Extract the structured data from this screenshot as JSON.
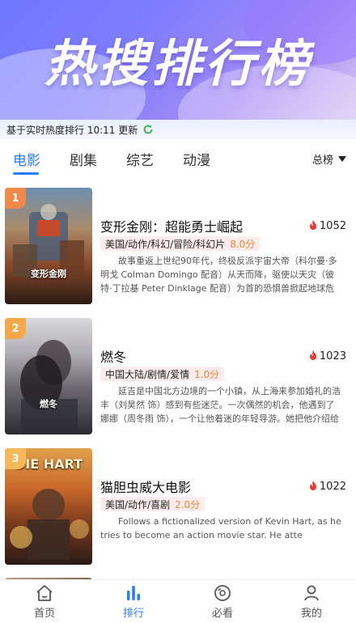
{
  "banner": {
    "title": "热搜排行榜"
  },
  "update": {
    "text": "基于实时热度排行 10:11 更新"
  },
  "tabs": [
    {
      "label": "电影",
      "active": true
    },
    {
      "label": "剧集",
      "active": false
    },
    {
      "label": "综艺",
      "active": false
    },
    {
      "label": "动漫",
      "active": false
    }
  ],
  "sort": {
    "label": "总榜"
  },
  "items": [
    {
      "rank": "1",
      "title": "变形金刚：超能勇士崛起",
      "heat": "1052",
      "tags": "美国/动作/科幻/冒险/科幻片",
      "score": "8.0分",
      "desc": "故事重返上世纪90年代，终极反派宇宙大帝（科尔曼·多明戈 Colman Domingo 配音）从天而降，驱使以天灾（彼特·丁拉基 Peter Dinklage 配音）为首的恐惧兽掀起地球危机。绝境",
      "poster_caption": "变形金刚",
      "badge_color": "#f08a4b"
    },
    {
      "rank": "2",
      "title": "燃冬",
      "heat": "1023",
      "tags": "中国大陆/剧情/爱情",
      "score": "1.0分",
      "desc": "延吉是中国北方边境的一个小镇，从上海来参加婚礼的浩丰（刘昊然 饰）感到有些迷茫。一次偶然的机会，他遇到了娜娜（周冬雨 饰），一个让他着迷的年轻导游。她把他介绍给一个厨师朋友韩萧",
      "poster_caption": "燃冬",
      "badge_color": "#f5a84a"
    },
    {
      "rank": "3",
      "title": "猫胆虫威大电影",
      "heat": "1022",
      "tags": "美国/动作/喜剧",
      "score": "2.0分",
      "desc": "Follows a fictionalized version of Kevin Hart, as he tries to become an action movie star. He atte",
      "poster_caption": "DIE HART",
      "badge_color": "#f6b95a"
    }
  ],
  "nav": [
    {
      "label": "首页",
      "icon": "home-icon",
      "active": false
    },
    {
      "label": "排行",
      "icon": "ranking-icon",
      "active": true
    },
    {
      "label": "必看",
      "icon": "must-watch-icon",
      "active": false
    },
    {
      "label": "我的",
      "icon": "profile-icon",
      "active": false
    }
  ],
  "colors": {
    "accent": "#2a7bf6",
    "heat": "#e8392f",
    "score": "#e9862f"
  }
}
